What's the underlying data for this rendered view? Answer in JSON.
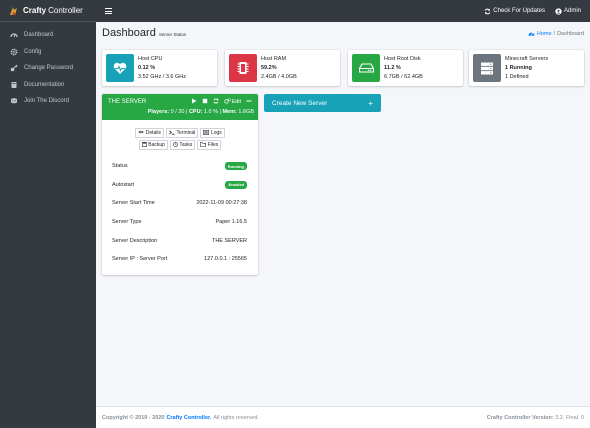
{
  "brand": {
    "bold": "Crafty",
    "rest": "Controller"
  },
  "sidebar": {
    "items": [
      {
        "label": "Dashboard",
        "icon": "tachometer-icon"
      },
      {
        "label": "Config",
        "icon": "gear-icon"
      },
      {
        "label": "Change Password",
        "icon": "key-icon"
      },
      {
        "label": "Documentation",
        "icon": "book-icon"
      },
      {
        "label": "Join The Discord",
        "icon": "discord-icon"
      }
    ]
  },
  "topbar": {
    "updates": "Check For Updates",
    "user": "Admin"
  },
  "page": {
    "title": "Dashboard",
    "subtitle": "Server Status"
  },
  "breadcrumb": {
    "home": "Home",
    "sep": "/",
    "current": "Dashboard"
  },
  "stats": [
    {
      "title": "Host CPU",
      "value": "0.12 %",
      "detail": "3.52 GHz / 3.6 GHz",
      "color": "#17a2b8",
      "icon": "heartbeat-icon"
    },
    {
      "title": "Host RAM",
      "value": "59.2%",
      "detail": "2.4GB / 4.0GB",
      "color": "#dc3545",
      "icon": "memory-icon"
    },
    {
      "title": "Host Root Disk",
      "value": "11.2 %",
      "detail": "6.7GB / 62.4GB",
      "color": "#28a745",
      "icon": "hdd-icon"
    },
    {
      "title": "Minecraft Servers",
      "value": "1 Running",
      "detail": "1 Defined",
      "color": "#6c757d",
      "icon": "server-icon"
    }
  ],
  "server": {
    "name": "THE SERVER",
    "edit": "Edit",
    "stats": {
      "players_label": "Players:",
      "players": "0 / 20",
      "cpu_label": "CPU:",
      "cpu": "1.0 %",
      "mem_label": "Mem:",
      "mem": "1.6GB",
      "sep": "|"
    },
    "tabs": [
      "Details",
      "Terminal",
      "Logs",
      "Backup",
      "Tasks",
      "Files"
    ],
    "details": [
      {
        "label": "Status",
        "value": "Running",
        "badge": true
      },
      {
        "label": "Autostart",
        "value": "Enabled",
        "badge": true
      },
      {
        "label": "Server Start Time",
        "value": "2022-11-09 00:27:38"
      },
      {
        "label": "Server Type",
        "value": "Paper 1.16.5"
      },
      {
        "label": "Server Description",
        "value": "THE SERVER"
      },
      {
        "label": "Server IP : Server Port",
        "value": "127.0.0.1 : 25565"
      }
    ]
  },
  "create_button": {
    "label": "Create New Server",
    "plus": "+"
  },
  "footer": {
    "copyright": "Copyright © 2019 - 2020",
    "brand_link": "Crafty Controller.",
    "rights": "All rights reserved.",
    "version_label": "Crafty Controller Version:",
    "version": "3.2. Final. 0"
  }
}
